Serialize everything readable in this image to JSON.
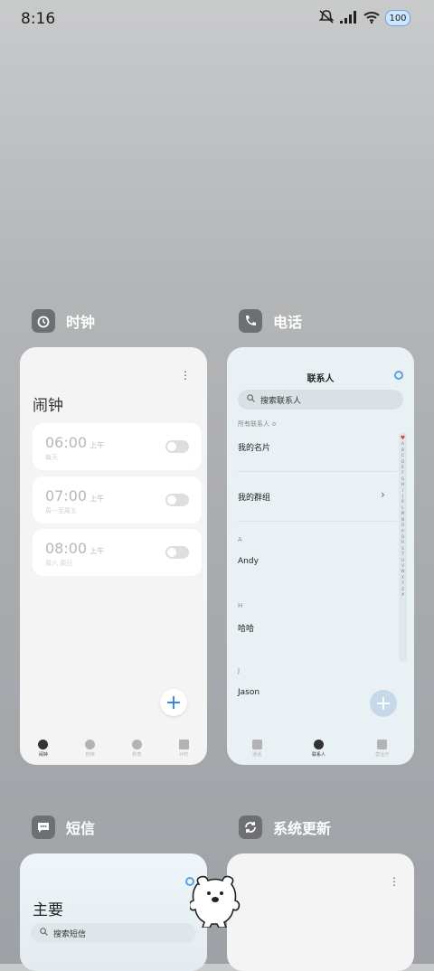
{
  "status_bar": {
    "time": "8:16",
    "battery": "100"
  },
  "apps": {
    "clock": {
      "label": "时钟",
      "title": "闹钟",
      "alarms": [
        {
          "time": "06:00",
          "ampm": "上午",
          "repeat": "每天"
        },
        {
          "time": "07:00",
          "ampm": "上午",
          "repeat": "周一至周五"
        },
        {
          "time": "08:00",
          "ampm": "上午",
          "repeat": "周六 周日"
        }
      ],
      "fab": "+",
      "tabs": [
        "闹钟",
        "时钟",
        "秒表",
        "计时"
      ],
      "active_tab": 0
    },
    "phone": {
      "label": "电话",
      "title": "联系人",
      "search_placeholder": "搜索联系人",
      "filter": "所有联系人 ≎",
      "my_card": "我的名片",
      "my_group": "我的群组",
      "sections": [
        {
          "letter": "A",
          "name": "Andy"
        },
        {
          "letter": "H",
          "name": "哈哈"
        },
        {
          "letter": "J",
          "name": "Jason"
        }
      ],
      "index": [
        "♥",
        "A",
        "B",
        "C",
        "D",
        "E",
        "F",
        "G",
        "H",
        "I",
        "J",
        "K",
        "L",
        "M",
        "N",
        "O",
        "P",
        "Q",
        "R",
        "S",
        "T",
        "U",
        "V",
        "W",
        "X",
        "Y",
        "Z",
        "#"
      ],
      "fab": "+",
      "tabs": [
        "通话",
        "联系人",
        "营业厅"
      ],
      "active_tab": 1
    },
    "sms": {
      "label": "短信",
      "title": "主要",
      "search_placeholder": "搜索短信"
    },
    "update": {
      "label": "系统更新"
    }
  },
  "colors": {
    "accent": "#2f7fe0",
    "fab_phone": "#c6d9ea"
  }
}
